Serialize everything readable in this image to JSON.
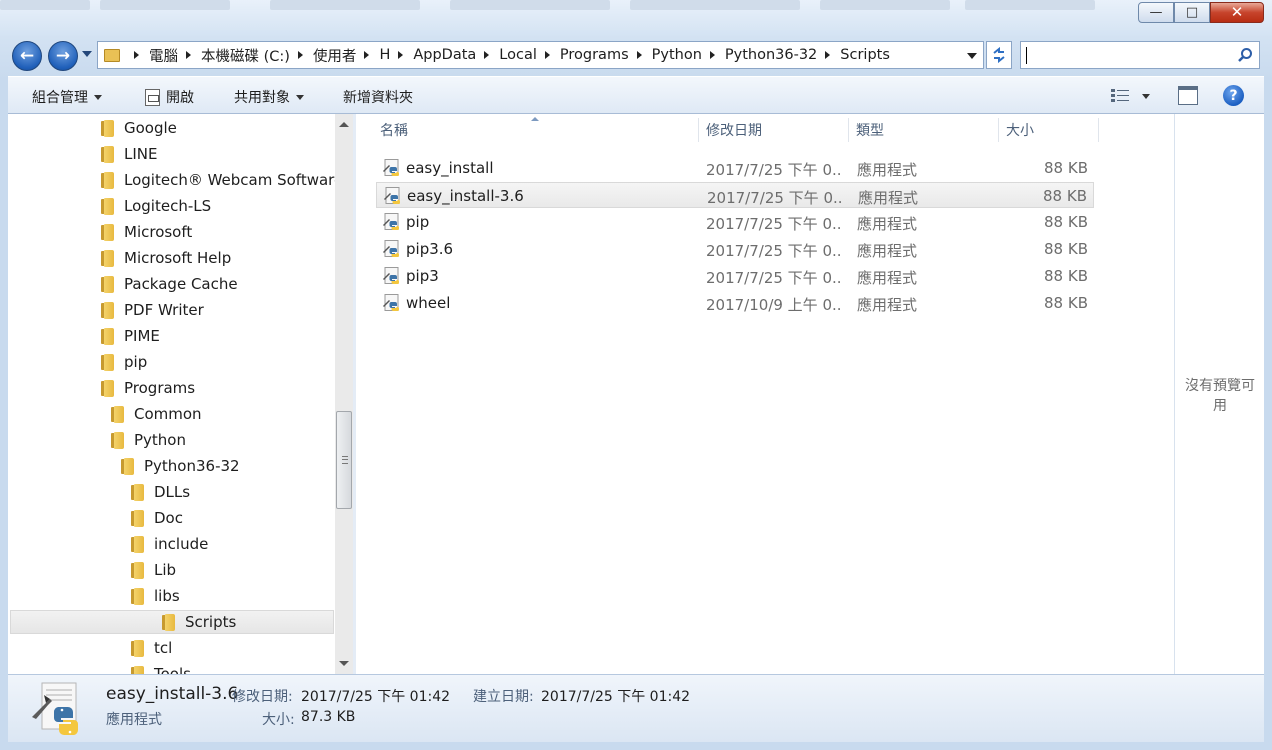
{
  "window": {
    "minimize_glyph": "—",
    "maximize_glyph": "□",
    "close_glyph": "✕"
  },
  "navigation": {
    "back_glyph": "←",
    "forward_glyph": "→",
    "breadcrumb": [
      "電腦",
      "本機磁碟 (C:)",
      "使用者",
      "H",
      "AppData",
      "Local",
      "Programs",
      "Python",
      "Python36-32",
      "Scripts"
    ],
    "search_placeholder": ""
  },
  "toolbar": {
    "organize_label": "組合管理",
    "open_label": "開啟",
    "share_label": "共用對象",
    "new_folder_label": "新增資料夾",
    "help_glyph": "?"
  },
  "tree": {
    "items": [
      {
        "label": "Google",
        "level": 0
      },
      {
        "label": "LINE",
        "level": 0
      },
      {
        "label": "Logitech® Webcam Software",
        "level": 0
      },
      {
        "label": "Logitech-LS",
        "level": 0
      },
      {
        "label": "Microsoft",
        "level": 0
      },
      {
        "label": "Microsoft Help",
        "level": 0
      },
      {
        "label": "Package Cache",
        "level": 0
      },
      {
        "label": "PDF Writer",
        "level": 0
      },
      {
        "label": "PIME",
        "level": 0
      },
      {
        "label": "pip",
        "level": 0
      },
      {
        "label": "Programs",
        "level": 0
      },
      {
        "label": "Common",
        "level": 1
      },
      {
        "label": "Python",
        "level": 1
      },
      {
        "label": "Python36-32",
        "level": 2
      },
      {
        "label": "DLLs",
        "level": 3
      },
      {
        "label": "Doc",
        "level": 3
      },
      {
        "label": "include",
        "level": 3
      },
      {
        "label": "Lib",
        "level": 3
      },
      {
        "label": "libs",
        "level": 3
      },
      {
        "label": "Scripts",
        "level": 3,
        "selected": true
      },
      {
        "label": "tcl",
        "level": 3
      },
      {
        "label": "Tools",
        "level": 3
      }
    ]
  },
  "columns": {
    "name": "名稱",
    "date": "修改日期",
    "type": "類型",
    "size": "大小"
  },
  "files": [
    {
      "name": "easy_install",
      "date": "2017/7/25 下午 0...",
      "type": "應用程式",
      "size": "88 KB"
    },
    {
      "name": "easy_install-3.6",
      "date": "2017/7/25 下午 0...",
      "type": "應用程式",
      "size": "88 KB",
      "selected": true
    },
    {
      "name": "pip",
      "date": "2017/7/25 下午 0...",
      "type": "應用程式",
      "size": "88 KB"
    },
    {
      "name": "pip3.6",
      "date": "2017/7/25 下午 0...",
      "type": "應用程式",
      "size": "88 KB"
    },
    {
      "name": "pip3",
      "date": "2017/7/25 下午 0...",
      "type": "應用程式",
      "size": "88 KB"
    },
    {
      "name": "wheel",
      "date": "2017/10/9 上午 0...",
      "type": "應用程式",
      "size": "88 KB"
    }
  ],
  "preview": {
    "message": "沒有預覽可用"
  },
  "details": {
    "name": "easy_install-3.6",
    "type": "應用程式",
    "modified_label": "修改日期:",
    "modified_value": "2017/7/25 下午 01:42",
    "created_label": "建立日期:",
    "created_value": "2017/7/25 下午 01:42",
    "size_label": "大小:",
    "size_value": "87.3 KB"
  },
  "colors": {
    "accent": "#1f5fb9",
    "folder": "#e8b940",
    "selection": "#e9e9e9"
  }
}
